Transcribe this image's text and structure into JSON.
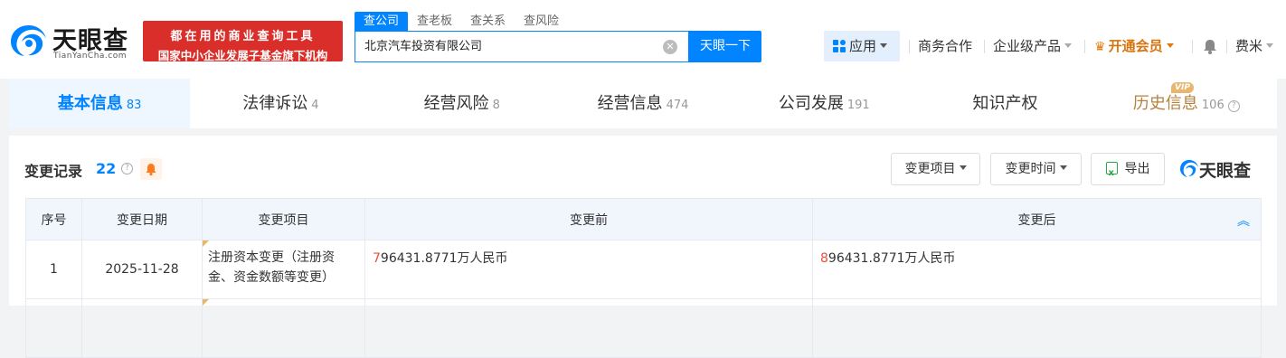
{
  "brand": {
    "name": "天眼查",
    "domain": "TianYanCha.com"
  },
  "banner": {
    "line1": "都在用的商业查询工具",
    "line2": "国家中小企业发展子基金旗下机构"
  },
  "search": {
    "tabs": [
      "查公司",
      "查老板",
      "查关系",
      "查风险"
    ],
    "value": "北京汽车投资有限公司",
    "button": "天眼一下"
  },
  "nav": {
    "app": "应用",
    "business": "商务合作",
    "enterprise": "企业级产品",
    "vip": "开通会员",
    "user": "费米"
  },
  "tabs": [
    {
      "label": "基本信息",
      "count": "83"
    },
    {
      "label": "法律诉讼",
      "count": "4"
    },
    {
      "label": "经营风险",
      "count": "8"
    },
    {
      "label": "经营信息",
      "count": "474"
    },
    {
      "label": "公司发展",
      "count": "191"
    },
    {
      "label": "知识产权",
      "count": ""
    },
    {
      "label": "历史信息",
      "count": "106",
      "badge": "VIP"
    }
  ],
  "section": {
    "title": "变更记录",
    "count": "22",
    "filter_item": "变更项目",
    "filter_time": "变更时间",
    "export": "导出",
    "logo": "天眼查"
  },
  "table": {
    "headers": [
      "序号",
      "变更日期",
      "变更项目",
      "变更前",
      "变更后"
    ],
    "rows": [
      {
        "index": "1",
        "date": "2025-11-28",
        "item": "注册资本变更（注册资金、资金数额等变更）",
        "before_hl": "7",
        "before_rest": "96431.8771万人民币",
        "after_hl": "8",
        "after_rest": "96431.8771万人民币"
      }
    ]
  },
  "colors": {
    "accent": "#0084ff",
    "brand_red": "#d92e2a",
    "vip": "#d9730d",
    "highlight": "#e84e3c"
  }
}
